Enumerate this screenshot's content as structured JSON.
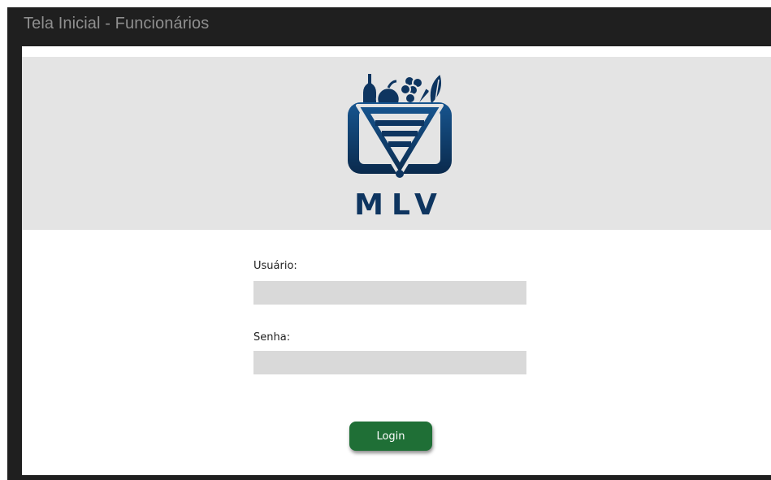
{
  "window": {
    "title": "Tela Inicial - Funcionários"
  },
  "logo": {
    "text": "MLV",
    "icon": "grocery-basket-logo",
    "color": "#0e3560"
  },
  "form": {
    "user_label": "Usuário:",
    "user_value": "",
    "password_label": "Senha:",
    "password_value": "",
    "login_label": "Login"
  },
  "colors": {
    "titlebar_bg": "#1f1f1f",
    "logo_band_bg": "#e4e4e4",
    "input_bg": "#d9d9d9",
    "button_bg": "#1f6f36"
  }
}
